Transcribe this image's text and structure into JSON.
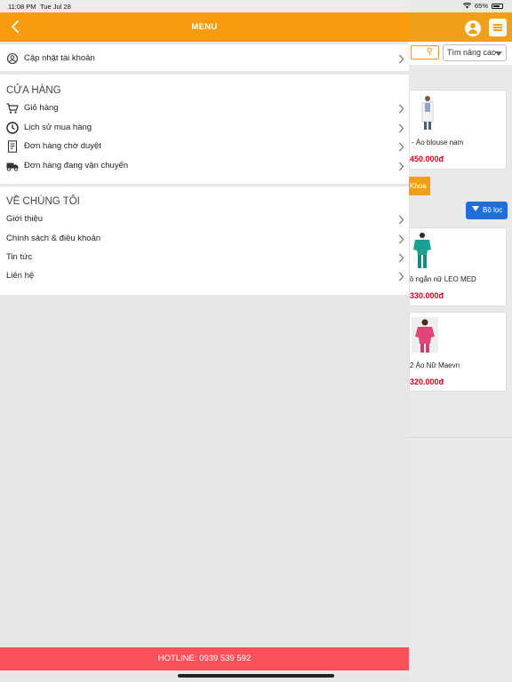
{
  "status_bar": {
    "time": "11:08 PM",
    "date": "Tue Jul 28",
    "battery": "65%"
  },
  "drawer": {
    "title": "MENU",
    "account_item": "Cập nhật tài khoản",
    "store_section": {
      "title": "CỬA HÀNG",
      "items": [
        {
          "label": "Giỏ hàng",
          "icon": "cart-icon"
        },
        {
          "label": "Lịch sử mua hàng",
          "icon": "history-clock-icon"
        },
        {
          "label": "Đơn hàng chờ duyệt",
          "icon": "document-icon"
        },
        {
          "label": "Đơn hàng đang vận chuyển",
          "icon": "truck-icon"
        }
      ]
    },
    "about_section": {
      "title": "VỀ CHÚNG TÔI",
      "items": [
        {
          "label": "Giới thiệu"
        },
        {
          "label": "Chính sách & điều khoản"
        },
        {
          "label": "Tin tức"
        },
        {
          "label": "Liên hệ"
        }
      ]
    },
    "hotline": "HOTLINE: 0939 539 592"
  },
  "background_app": {
    "advanced_search": "Tìm nâng cao",
    "filter_button": "Bộ lọc",
    "category_tag": "Khoa",
    "products": [
      {
        "name": "- Áo blouse nam",
        "price": "450.000đ"
      },
      {
        "name": "ồ ngắn nữ LEO MED",
        "price": "330.000đ"
      },
      {
        "name": "2 Áo Nữ Maevn",
        "price": "320.000đ"
      }
    ]
  },
  "colors": {
    "header": "#f89c0e",
    "hotline": "#f9525a",
    "price": "#d0021b",
    "filter": "#1e6fd9"
  }
}
